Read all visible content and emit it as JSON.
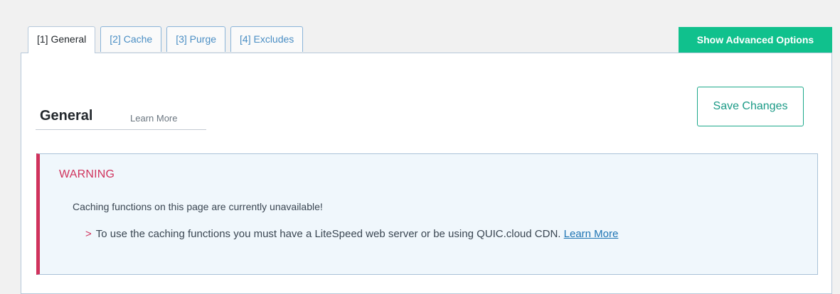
{
  "tabs": [
    {
      "label": "[1] General",
      "active": true
    },
    {
      "label": "[2] Cache",
      "active": false
    },
    {
      "label": "[3] Purge",
      "active": false
    },
    {
      "label": "[4] Excludes",
      "active": false
    }
  ],
  "header": {
    "advanced_label": "Show Advanced Options"
  },
  "section": {
    "title": "General",
    "learn_more": "Learn More"
  },
  "actions": {
    "save_label": "Save Changes"
  },
  "warning": {
    "title": "WARNING",
    "message": "Caching functions on this page are currently unavailable!",
    "detail_arrow": ">",
    "detail": "To use the caching functions you must have a LiteSpeed web server or be using QUIC.cloud CDN.",
    "link": "Learn More"
  },
  "colors": {
    "accent_green": "#10c18d",
    "warning_red": "#d0325c",
    "link_blue": "#1e74b3",
    "notice_bg": "#f0f7fc"
  }
}
